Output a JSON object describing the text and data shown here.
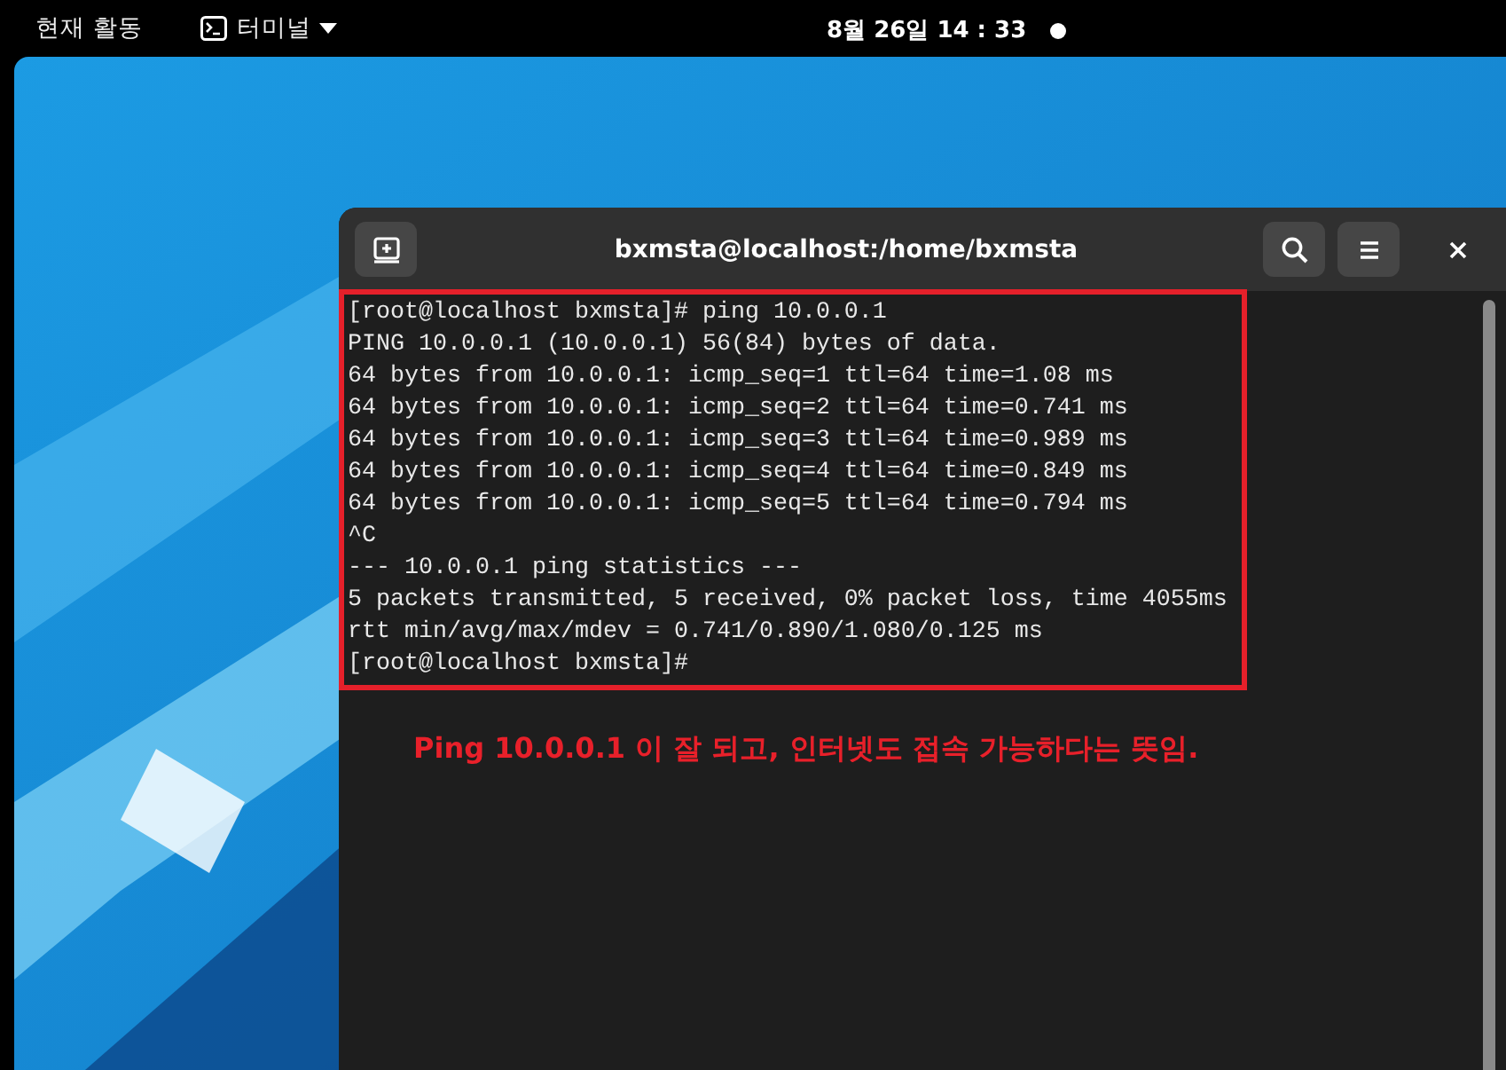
{
  "top_bar": {
    "activities": "현재 활동",
    "app_menu": "터미널",
    "clock": "8월 26일  14 : 33"
  },
  "window": {
    "title": "bxmsta@localhost:/home/bxmsta"
  },
  "terminal": {
    "lines": [
      "[root@localhost bxmsta]# ping 10.0.0.1",
      "PING 10.0.0.1 (10.0.0.1) 56(84) bytes of data.",
      "64 bytes from 10.0.0.1: icmp_seq=1 ttl=64 time=1.08 ms",
      "64 bytes from 10.0.0.1: icmp_seq=2 ttl=64 time=0.741 ms",
      "64 bytes from 10.0.0.1: icmp_seq=3 ttl=64 time=0.989 ms",
      "64 bytes from 10.0.0.1: icmp_seq=4 ttl=64 time=0.849 ms",
      "64 bytes from 10.0.0.1: icmp_seq=5 ttl=64 time=0.794 ms",
      "^C",
      "--- 10.0.0.1 ping statistics ---",
      "5 packets transmitted, 5 received, 0% packet loss, time 4055ms",
      "rtt min/avg/max/mdev = 0.741/0.890/1.080/0.125 ms",
      "[root@localhost bxmsta]#"
    ]
  },
  "annotation": "Ping 10.0.0.1 이 잘 되고, 인터넷도 접속 가능하다는 뜻임."
}
